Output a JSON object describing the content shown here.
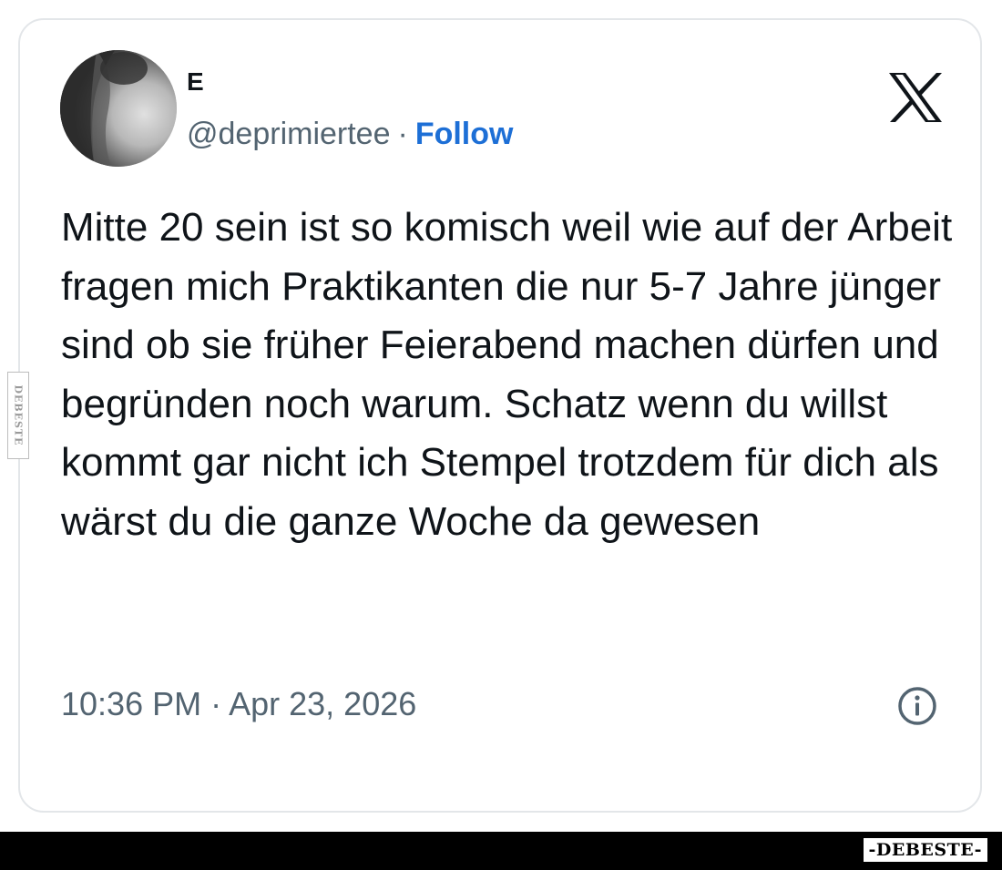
{
  "tweet": {
    "author": {
      "name": "E",
      "handle": "@deprimiertee",
      "separator": "·",
      "follow_label": "Follow"
    },
    "text": "Mitte 20 sein ist so komisch weil wie auf der Arbeit fragen mich Praktikanten die nur 5-7 Jahre jünger sind ob sie früher Feierabend machen dürfen und begründen noch warum. Schatz wenn du willst kommt gar nicht ich Stempel trotzdem für dich als wärst du die ganze Woche da gewesen",
    "timestamp": "10:36 PM · Apr 23, 2026"
  },
  "icons": {
    "platform": "x-logo-icon",
    "info": "info-icon"
  },
  "watermark": {
    "brand": "-DEBESTE-",
    "side": "DEBESTE"
  },
  "colors": {
    "follow": "#1d6fd6",
    "text": "#0f1419",
    "muted": "#536471",
    "border": "#e3e6e9"
  }
}
